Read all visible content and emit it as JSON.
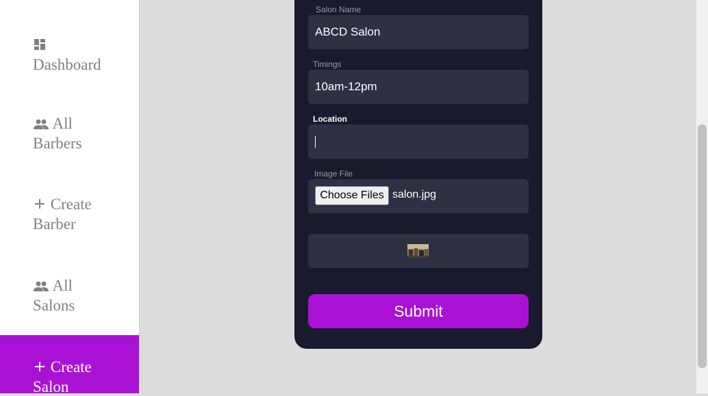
{
  "sidebar": {
    "items": [
      {
        "icon": "dashboard-icon",
        "label": "Dashboard"
      },
      {
        "icon": "people-icon",
        "label": "All\nBarbers"
      },
      {
        "icon": "plus-icon",
        "label": "Create\nBarber"
      },
      {
        "icon": "people-icon",
        "label": "All\nSalons"
      },
      {
        "icon": "plus-icon",
        "label": "Create\nSalon",
        "active": true
      }
    ]
  },
  "form": {
    "salon_name": {
      "label": "Salon Name",
      "value": "ABCD Salon"
    },
    "timings": {
      "label": "Timings",
      "value": "10am-12pm"
    },
    "location": {
      "label": "Location",
      "value": ""
    },
    "image_file": {
      "label": "Image File",
      "button_label": "Choose Files",
      "file_name": "salon.jpg"
    },
    "submit_label": "Submit"
  },
  "colors": {
    "accent": "#a912d4",
    "card_bg": "#191a2e",
    "field_bg": "#2e3044",
    "page_bg": "#dcdcdc"
  }
}
